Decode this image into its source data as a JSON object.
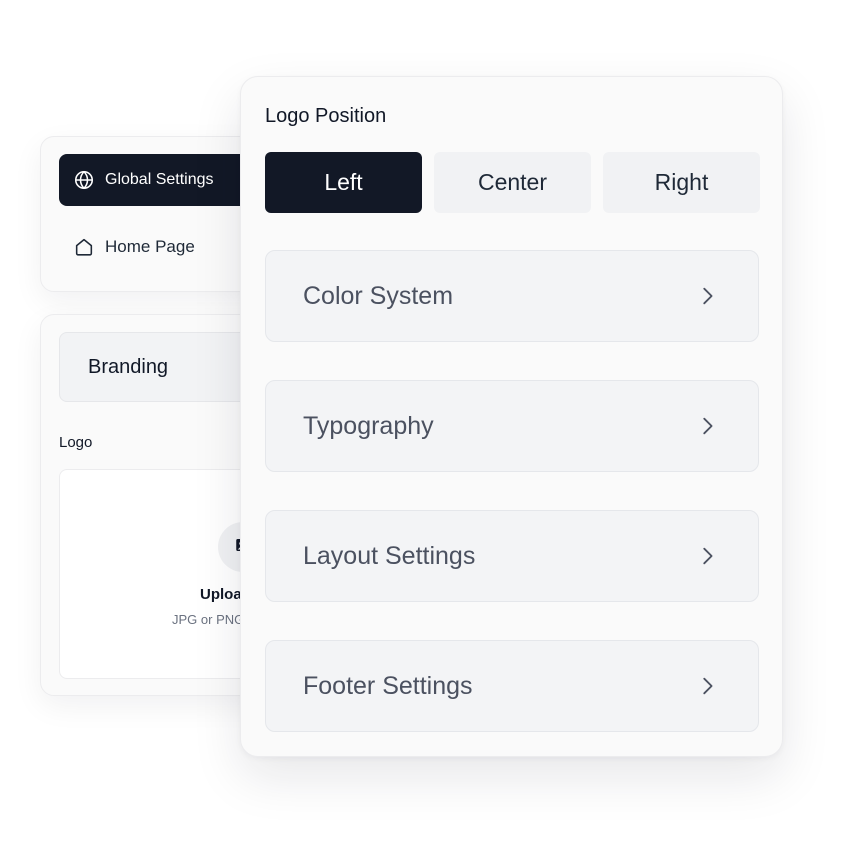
{
  "nav": {
    "items": [
      {
        "label": "Global Settings",
        "icon": "globe-icon",
        "active": true
      },
      {
        "label": "Home Page",
        "icon": "home-icon",
        "active": false
      }
    ]
  },
  "branding": {
    "section_label": "Branding",
    "logo_label": "Logo",
    "upload_title": "Uploa",
    "upload_hint": "JPG or PNG"
  },
  "logo_position": {
    "title": "Logo Position",
    "options": [
      "Left",
      "Center",
      "Right"
    ],
    "selected": "Left"
  },
  "settings_sections": [
    {
      "label": "Color System",
      "icon": "chevron-right-icon"
    },
    {
      "label": "Typography",
      "icon": "chevron-right-icon"
    },
    {
      "label": "Layout Settings",
      "icon": "chevron-right-icon"
    },
    {
      "label": "Footer Settings",
      "icon": "chevron-right-icon"
    }
  ],
  "colors": {
    "active_bg": "#121826",
    "active_text": "#ffffff",
    "inactive_bg": "#f1f2f4",
    "accordion_text": "#4b5160"
  }
}
